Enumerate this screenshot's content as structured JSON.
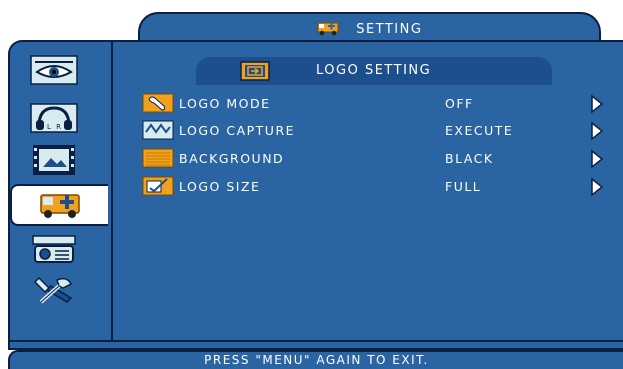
{
  "menu": {
    "title": "SETTING",
    "title_icon": "ambulance-icon"
  },
  "sidebar": {
    "items": [
      {
        "name": "picture-eye-icon",
        "active": false
      },
      {
        "name": "audio-headphones-icon",
        "active": false
      },
      {
        "name": "image-film-icon",
        "active": false
      },
      {
        "name": "setting-ambulance-icon",
        "active": true
      },
      {
        "name": "projector-icon",
        "active": false
      },
      {
        "name": "tools-icon",
        "active": false
      }
    ]
  },
  "section": {
    "title": "LOGO SETTING",
    "icon": "logo-setting-icon"
  },
  "rows": [
    {
      "label": "LOGO MODE",
      "value": "OFF",
      "icon": "logo-mode-icon"
    },
    {
      "label": "LOGO CAPTURE",
      "value": "EXECUTE",
      "icon": "logo-capture-icon"
    },
    {
      "label": "BACKGROUND",
      "value": "BLACK",
      "icon": "background-icon"
    },
    {
      "label": "LOGO SIZE",
      "value": "FULL",
      "icon": "logo-size-icon"
    }
  ],
  "footer": {
    "text": "PRESS \"MENU\" AGAIN TO EXIT."
  },
  "colors": {
    "panel": "#2a64a2",
    "header": "#1d4f8e",
    "border": "#0b1e44",
    "icon_orange": "#f2a11f",
    "text": "#ffffff"
  }
}
